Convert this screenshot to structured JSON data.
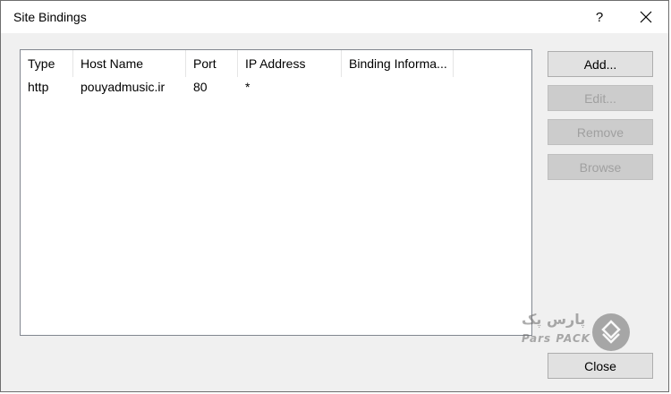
{
  "window": {
    "title": "Site Bindings",
    "help_label": "?",
    "close_icon": "close-icon"
  },
  "bindings_table": {
    "columns": [
      "Type",
      "Host Name",
      "Port",
      "IP Address",
      "Binding Informa..."
    ],
    "rows": [
      {
        "type": "http",
        "host_name": "pouyadmusic.ir",
        "port": "80",
        "ip_address": "*",
        "binding_information": ""
      }
    ]
  },
  "buttons": {
    "add": {
      "label": "Add...",
      "enabled": true
    },
    "edit": {
      "label": "Edit...",
      "enabled": false
    },
    "remove": {
      "label": "Remove",
      "enabled": false
    },
    "browse": {
      "label": "Browse",
      "enabled": false
    },
    "close": {
      "label": "Close",
      "enabled": true
    }
  },
  "watermark": {
    "brand_persian": "پارس پک",
    "brand_latin": "Pars PACK",
    "icon": "parspack-logo-icon"
  },
  "colors": {
    "dialog_bg": "#f0f0f0",
    "titlebar_bg": "#ffffff",
    "button_bg": "#e1e1e1",
    "disabled_text": "#a0a0a0"
  }
}
